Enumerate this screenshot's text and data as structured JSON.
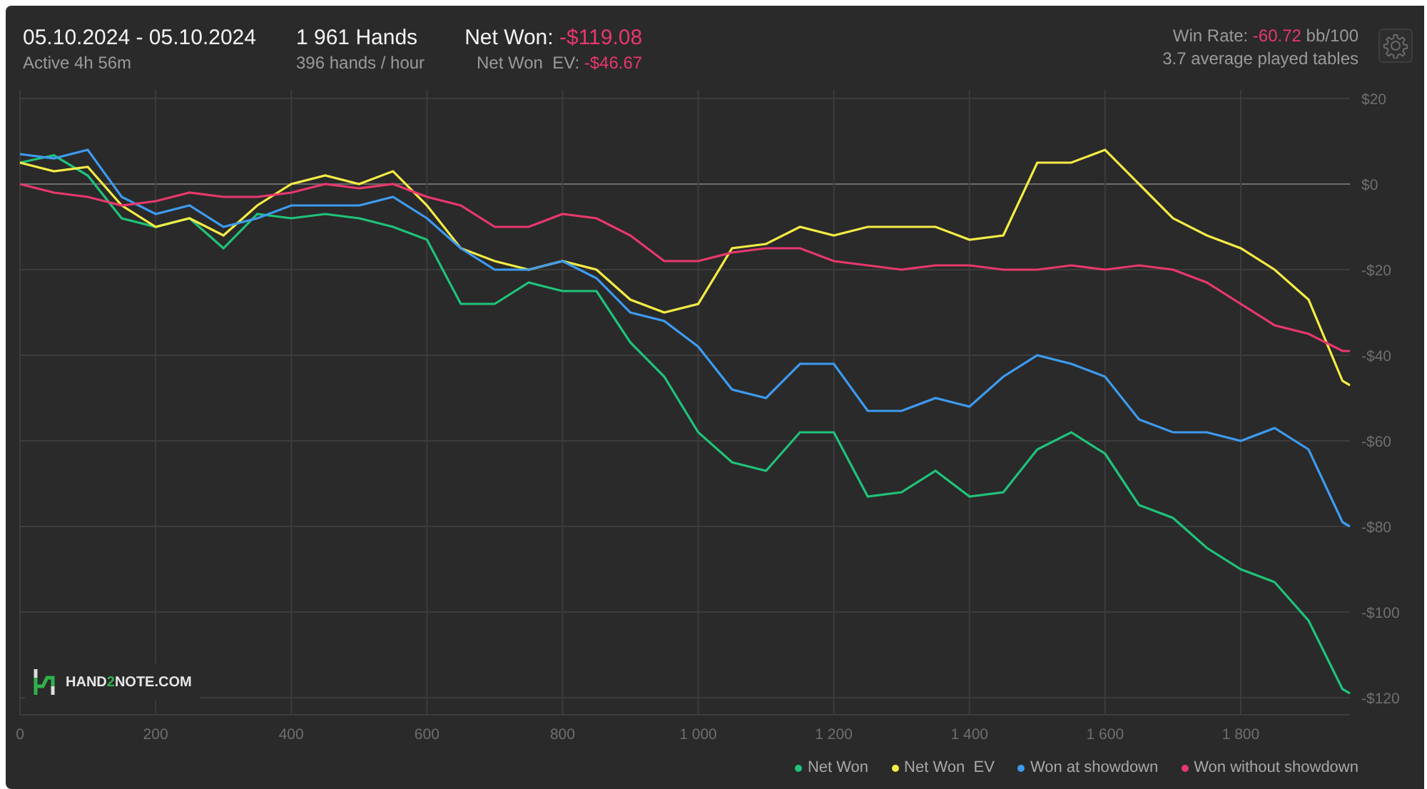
{
  "header": {
    "date_range": "05.10.2024 - 05.10.2024",
    "active": "Active 4h 56m",
    "hands": "1 961 Hands",
    "hands_per_hour": "396 hands / hour",
    "net_won_label": "Net Won:",
    "net_won_value": "-$119.08",
    "net_won_ev_label": "Net Won  EV:",
    "net_won_ev_value": "-$46.67",
    "win_rate_label": "Win Rate:",
    "win_rate_value": "-60.72",
    "win_rate_unit": "bb/100",
    "tables": "3.7 average played tables"
  },
  "chart": {
    "brand": {
      "before": "HAND",
      "accent": "2",
      "after": "NOTE.COM"
    },
    "chart_data": {
      "type": "line",
      "grid": true,
      "xlim": [
        0,
        1961
      ],
      "ylim": [
        -124,
        22
      ],
      "xticks": [
        {
          "value": 0,
          "label": "0"
        },
        {
          "value": 200,
          "label": "200"
        },
        {
          "value": 400,
          "label": "400"
        },
        {
          "value": 600,
          "label": "600"
        },
        {
          "value": 800,
          "label": "800"
        },
        {
          "value": 1000,
          "label": "1 000"
        },
        {
          "value": 1200,
          "label": "1 200"
        },
        {
          "value": 1400,
          "label": "1 400"
        },
        {
          "value": 1600,
          "label": "1 600"
        },
        {
          "value": 1800,
          "label": "1 800"
        }
      ],
      "yticks": [
        {
          "value": 20,
          "label": "$20"
        },
        {
          "value": 0,
          "label": "$0"
        },
        {
          "value": -20,
          "label": "-$20"
        },
        {
          "value": -40,
          "label": "-$40"
        },
        {
          "value": -60,
          "label": "-$60"
        },
        {
          "value": -80,
          "label": "-$80"
        },
        {
          "value": -100,
          "label": "-$100"
        },
        {
          "value": -120,
          "label": "-$120"
        }
      ],
      "x": [
        0,
        50,
        100,
        150,
        200,
        250,
        300,
        350,
        400,
        450,
        500,
        550,
        600,
        650,
        700,
        750,
        800,
        850,
        900,
        950,
        1000,
        1050,
        1100,
        1150,
        1200,
        1250,
        1300,
        1350,
        1400,
        1450,
        1500,
        1550,
        1600,
        1650,
        1700,
        1750,
        1800,
        1850,
        1900,
        1950,
        1961
      ],
      "series": [
        {
          "name": "Net Won",
          "color": "#1fc37a",
          "values": [
            5,
            6.7,
            2,
            -8,
            -10,
            -8,
            -15,
            -7,
            -8,
            -7,
            -8,
            -10,
            -13,
            -28,
            -28,
            -23,
            -25,
            -25,
            -37,
            -45,
            -58,
            -65,
            -67,
            -58,
            -58,
            -73,
            -72,
            -67,
            -73,
            -72,
            -62,
            -58,
            -63,
            -75,
            -78,
            -85,
            -90,
            -93,
            -102,
            -118,
            -119
          ]
        },
        {
          "name": "Net Won  EV",
          "color": "#f5ec45",
          "values": [
            5,
            3,
            4,
            -5,
            -10,
            -8,
            -12,
            -5,
            0,
            2,
            0,
            3,
            -5,
            -15,
            -18,
            -20,
            -18,
            -20,
            -27,
            -30,
            -28,
            -15,
            -14,
            -10,
            -12,
            -10,
            -10,
            -10,
            -13,
            -12,
            5,
            5,
            8,
            0,
            -8,
            -12,
            -15,
            -20,
            -27,
            -46,
            -47
          ]
        },
        {
          "name": "Won at showdown",
          "color": "#3d9bf0",
          "values": [
            7,
            6,
            8,
            -3,
            -7,
            -5,
            -10,
            -8,
            -5,
            -5,
            -5,
            -3,
            -8,
            -15,
            -20,
            -20,
            -18,
            -22,
            -30,
            -32,
            -38,
            -48,
            -50,
            -42,
            -42,
            -53,
            -53,
            -50,
            -52,
            -45,
            -40,
            -42,
            -45,
            -55,
            -58,
            -58,
            -60,
            -57,
            -62,
            -79,
            -80
          ]
        },
        {
          "name": "Won without showdown",
          "color": "#e8386d",
          "values": [
            0,
            -2,
            -3,
            -5,
            -4,
            -2,
            -3,
            -3,
            -2,
            0,
            -1,
            0,
            -3,
            -5,
            -10,
            -10,
            -7,
            -8,
            -12,
            -18,
            -18,
            -16,
            -15,
            -15,
            -18,
            -19,
            -20,
            -19,
            -19,
            -20,
            -20,
            -19,
            -20,
            -19,
            -20,
            -23,
            -28,
            -33,
            -35,
            -39,
            -39
          ]
        }
      ]
    }
  }
}
